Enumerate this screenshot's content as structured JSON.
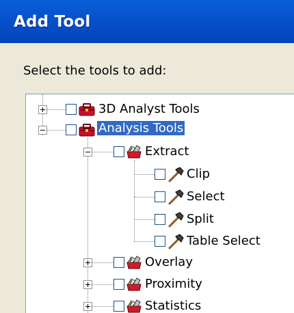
{
  "window": {
    "title": "Add Tool"
  },
  "prompt": "Select the tools to add:",
  "tree": {
    "nodes": [
      {
        "label": "3D Analyst Tools",
        "icon": "toolbox-icon",
        "expander": "+",
        "selected": false
      },
      {
        "label": "Analysis Tools",
        "icon": "toolbox-icon",
        "expander": "-",
        "selected": true
      },
      {
        "label": "Extract",
        "icon": "toolset-icon",
        "expander": "-",
        "selected": false
      },
      {
        "label": "Clip",
        "icon": "hammer-tool-icon",
        "selected": false
      },
      {
        "label": "Select",
        "icon": "hammer-tool-icon",
        "selected": false
      },
      {
        "label": "Split",
        "icon": "hammer-tool-icon",
        "selected": false
      },
      {
        "label": "Table Select",
        "icon": "hammer-tool-icon",
        "selected": false
      },
      {
        "label": "Overlay",
        "icon": "toolset-icon",
        "expander": "+",
        "selected": false
      },
      {
        "label": "Proximity",
        "icon": "toolset-icon",
        "expander": "+",
        "selected": false
      },
      {
        "label": "Statistics",
        "icon": "toolset-icon",
        "expander": "+",
        "selected": false
      }
    ]
  },
  "colors": {
    "titlebar": "#0554cc",
    "selection": "#316ac5",
    "dialog_bg": "#ece9d8"
  }
}
